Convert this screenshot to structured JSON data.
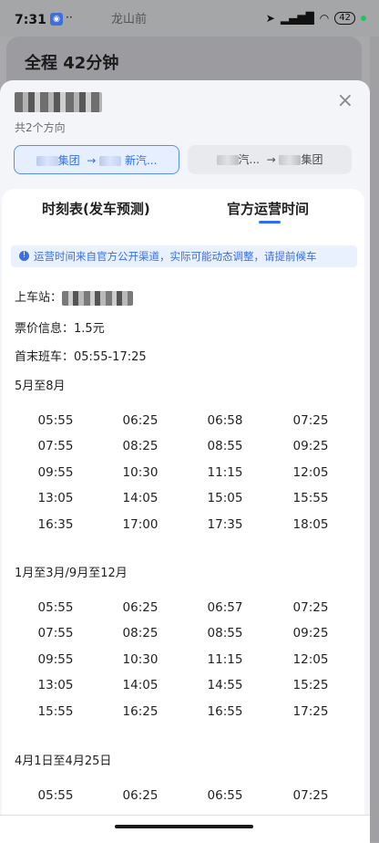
{
  "status_bar": {
    "time": "7:31",
    "dots": "··",
    "map_label": "龙山前",
    "battery": "42"
  },
  "background": {
    "title": "全程 42分钟"
  },
  "sheet": {
    "close": "×",
    "direction_count": "共2个方向",
    "directions": [
      {
        "from": "集团",
        "arrow": "→",
        "to": "新汽..."
      },
      {
        "from": "汽...",
        "arrow": "→",
        "to": "集团"
      }
    ],
    "tabs": [
      {
        "label": "时刻表(发车预测)"
      },
      {
        "label": "官方运营时间"
      }
    ],
    "notice": "运营时间来自官方公开渠道，实际可能动态调整，请提前候车",
    "boarding_label": "上车站：",
    "fare_label": "票价信息：",
    "fare_value": "1.5元",
    "first_last_label": "首末班车：",
    "first_last_value": "05:55-17:25",
    "schedules": [
      {
        "title": "5月至8月",
        "times": [
          "05:55",
          "06:25",
          "06:58",
          "07:25",
          "07:55",
          "08:25",
          "08:55",
          "09:25",
          "09:55",
          "10:30",
          "11:15",
          "12:05",
          "13:05",
          "14:05",
          "15:05",
          "15:55",
          "16:35",
          "17:00",
          "17:35",
          "18:05"
        ]
      },
      {
        "title": "1月至3月/9月至12月",
        "times": [
          "05:55",
          "06:25",
          "06:57",
          "07:25",
          "07:55",
          "08:25",
          "08:55",
          "09:25",
          "09:55",
          "10:30",
          "11:15",
          "12:05",
          "13:05",
          "14:05",
          "14:55",
          "15:25",
          "15:55",
          "16:25",
          "16:55",
          "17:25"
        ]
      },
      {
        "title": "4月1日至4月25日",
        "times": [
          "05:55",
          "06:25",
          "06:55",
          "07:25"
        ]
      }
    ]
  }
}
